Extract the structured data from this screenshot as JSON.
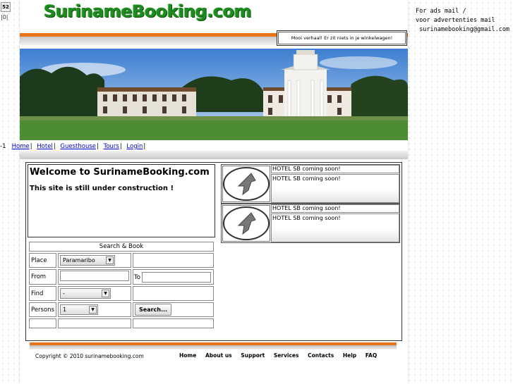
{
  "counter": {
    "value": "52",
    "sub": "|0|"
  },
  "header": {
    "logo": "SurinameBooking.com",
    "cart": "Mooi verhaal! Er zit niets in je winkelwagen!"
  },
  "nav": {
    "prefix": "-1",
    "items": [
      {
        "label": "Home"
      },
      {
        "label": "Hotel"
      },
      {
        "label": "Guesthouse"
      },
      {
        "label": "Tours"
      },
      {
        "label": "Login"
      }
    ]
  },
  "welcome": {
    "title": "Welcome to SurinameBooking.com",
    "text": "This site is still under construction !"
  },
  "search": {
    "title": "Search & Book",
    "place_label": "Place",
    "place_value": "Paramaribo",
    "from_label": "From",
    "to_label": "To",
    "find_label": "Find",
    "find_value": "-",
    "persons_label": "Persons",
    "persons_value": "1",
    "search_button": "Search..."
  },
  "hotels": [
    {
      "title": "HOTEL SB coming soon!",
      "desc": "HOTEL SB coming soon!"
    },
    {
      "title": "HOTEL SB coming soon!",
      "desc": "HOTEL SB coming soon!"
    }
  ],
  "footer": {
    "copyright": "Copyright © 2010 surinamebooking.com",
    "links": [
      "Home",
      "About us",
      "Support",
      "Services",
      "Contacts",
      "Help",
      "FAQ"
    ]
  },
  "ads": {
    "line1": "For ads mail /",
    "line2": "voor advertenties mail",
    "line3": " surinamebooking@gmail.com"
  },
  "colors": {
    "accent": "#e8741a",
    "logo": "#1f8a1f",
    "link": "#0000cc"
  }
}
